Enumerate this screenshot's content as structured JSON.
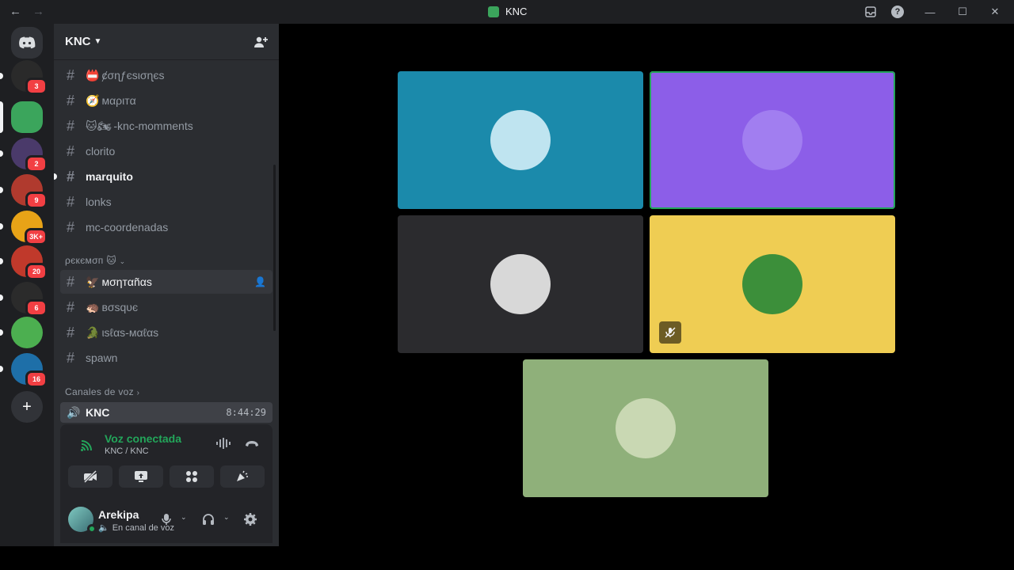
{
  "titlebar": {
    "title": "KNC",
    "back_icon": "arrow-left-icon",
    "forward_icon": "arrow-right-icon",
    "help_label": "?"
  },
  "servers": [
    {
      "name": "server-cat",
      "badge": "3",
      "color": "#2a2a2a"
    },
    {
      "name": "server-knc",
      "badge": "",
      "color": "#3ba55c",
      "active": true
    },
    {
      "name": "server-anime",
      "badge": "2",
      "color": "#4a3a6a"
    },
    {
      "name": "server-network",
      "badge": "9",
      "color": "#b03a2e"
    },
    {
      "name": "server-yellow",
      "badge": "3K+",
      "color": "#e8a317"
    },
    {
      "name": "server-pokemon",
      "badge": "20",
      "color": "#c0392b"
    },
    {
      "name": "server-bw",
      "badge": "6",
      "color": "#2b2b2b"
    },
    {
      "name": "server-minecraft",
      "badge": "",
      "color": "#4caf50"
    },
    {
      "name": "server-blue",
      "badge": "16",
      "color": "#1e6fa8"
    }
  ],
  "add_server_label": "+",
  "server": {
    "name": "KNC"
  },
  "channels": [
    {
      "emoji": "📛",
      "label": "ȼσɳƒєѕισɳєѕ",
      "state": "normal"
    },
    {
      "emoji": "🧭",
      "label": "мαριтα",
      "state": "normal"
    },
    {
      "emoji": "🐱🏍",
      "label": "-knc-momments",
      "state": "normal"
    },
    {
      "emoji": "",
      "label": "clorito",
      "state": "normal"
    },
    {
      "emoji": "",
      "label": "marquito",
      "state": "unread"
    },
    {
      "emoji": "",
      "label": "lonks",
      "state": "normal"
    },
    {
      "emoji": "",
      "label": "mc-coordenadas",
      "state": "normal"
    }
  ],
  "category_pokemon": "ρєкємσп 🐱",
  "pokemon_channels": [
    {
      "emoji": "🦅",
      "label": "мσηтαñαѕ",
      "state": "hover"
    },
    {
      "emoji": "🦔",
      "label": "вσѕqυє",
      "state": "normal"
    },
    {
      "emoji": "🐊",
      "label": "ιѕℓαѕ-мαℓαѕ",
      "state": "normal"
    },
    {
      "emoji": "",
      "label": "spawn",
      "state": "normal"
    }
  ],
  "category_voice": "Canales de voz",
  "voice_channel": {
    "name": "KNC",
    "timer": "8:44:29"
  },
  "voice_panel": {
    "status": "Voz conectada",
    "location": "KNC / KNC"
  },
  "user": {
    "name": "Arekipa",
    "status": "En canal de voz"
  },
  "tiles": [
    {
      "name": "tile-user-1",
      "color": "#1b8aab",
      "avatar_color": "#bfe4f0",
      "speaking": false,
      "muted": false
    },
    {
      "name": "tile-bot",
      "color": "#8c5ee8",
      "avatar_color": "#a17ef0",
      "speaking": true,
      "muted": false
    },
    {
      "name": "tile-user-2",
      "color": "#2b2b2e",
      "avatar_color": "#d8d8d8",
      "speaking": false,
      "muted": false
    },
    {
      "name": "tile-user-3",
      "color": "#efcd53",
      "avatar_color": "#3c8f3a",
      "speaking": false,
      "muted": true
    },
    {
      "name": "tile-user-4",
      "color": "#8fb07a",
      "avatar_color": "#c9d8b3",
      "speaking": false,
      "muted": false
    }
  ]
}
